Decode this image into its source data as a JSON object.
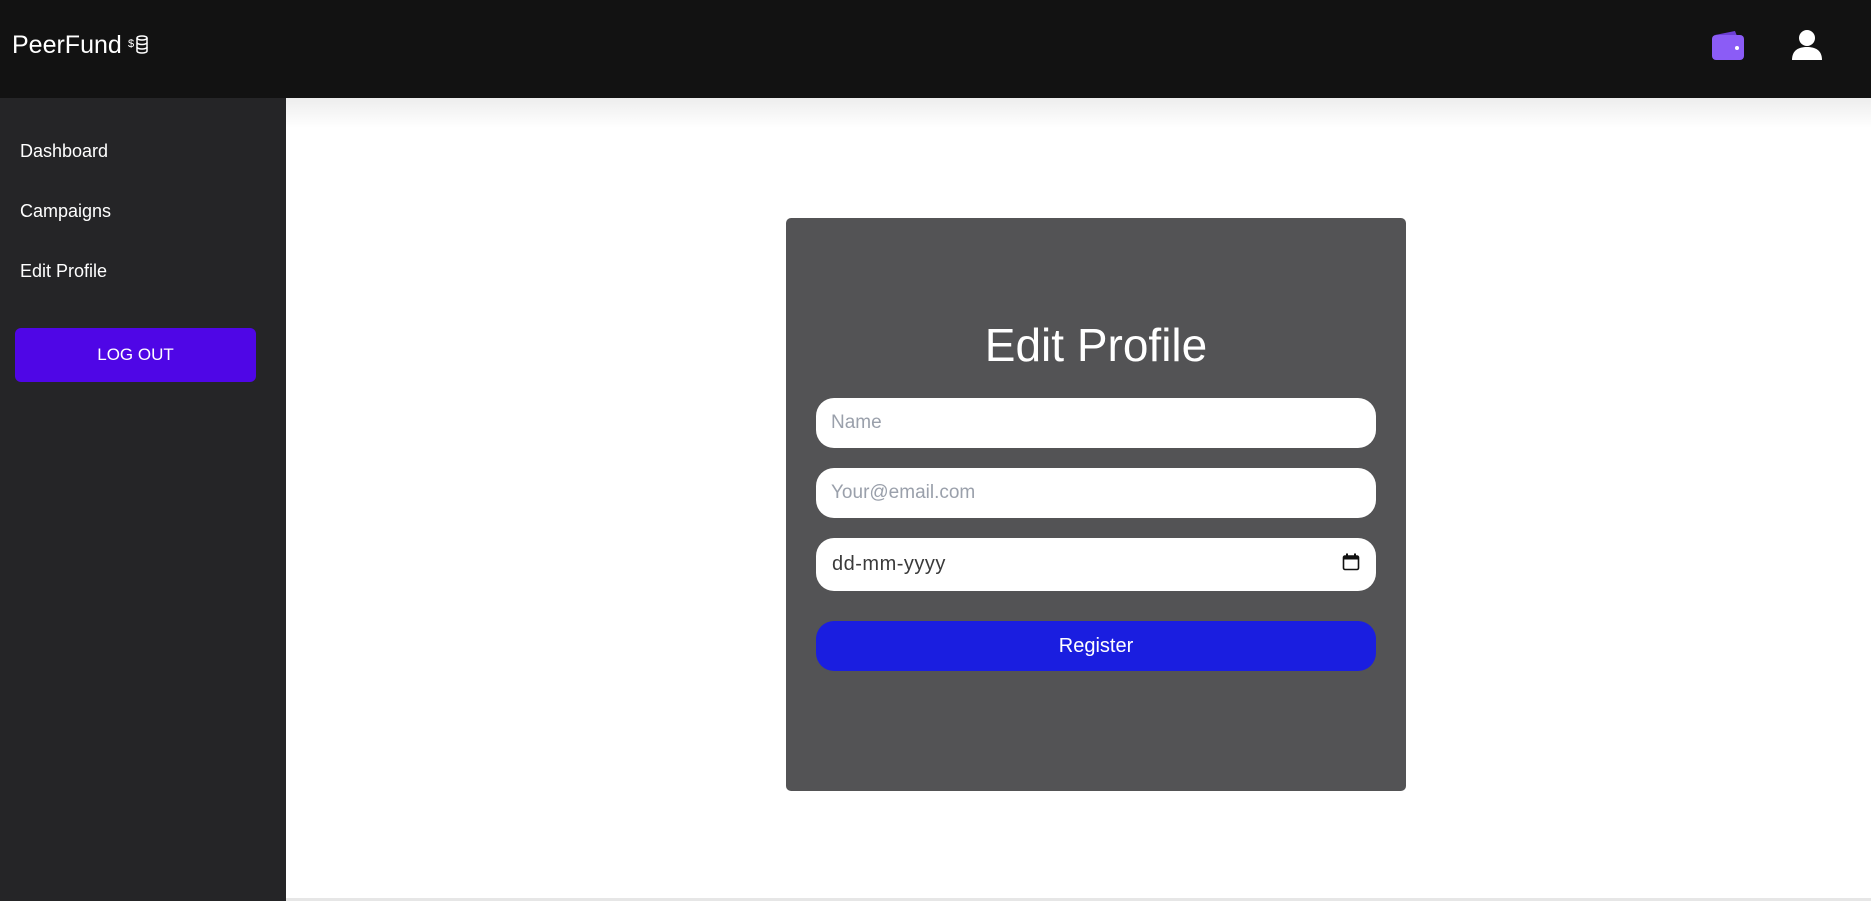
{
  "app": {
    "brand": "PeerFund",
    "brand_icon": "coin-stack-icon"
  },
  "header": {
    "icons": [
      "wallet-icon",
      "user-icon"
    ],
    "wallet_color": "#8b5cf6"
  },
  "sidebar": {
    "items": [
      {
        "label": "Dashboard"
      },
      {
        "label": "Campaigns"
      },
      {
        "label": "Edit Profile"
      }
    ],
    "logout_label": "LOG OUT",
    "logout_color": "#4f06e6"
  },
  "form": {
    "title": "Edit Profile",
    "name_placeholder": "Name",
    "email_placeholder": "Your@email.com",
    "date_placeholder": "dd-mm-yyyy",
    "submit_label": "Register",
    "submit_color": "#1a1ee0"
  }
}
